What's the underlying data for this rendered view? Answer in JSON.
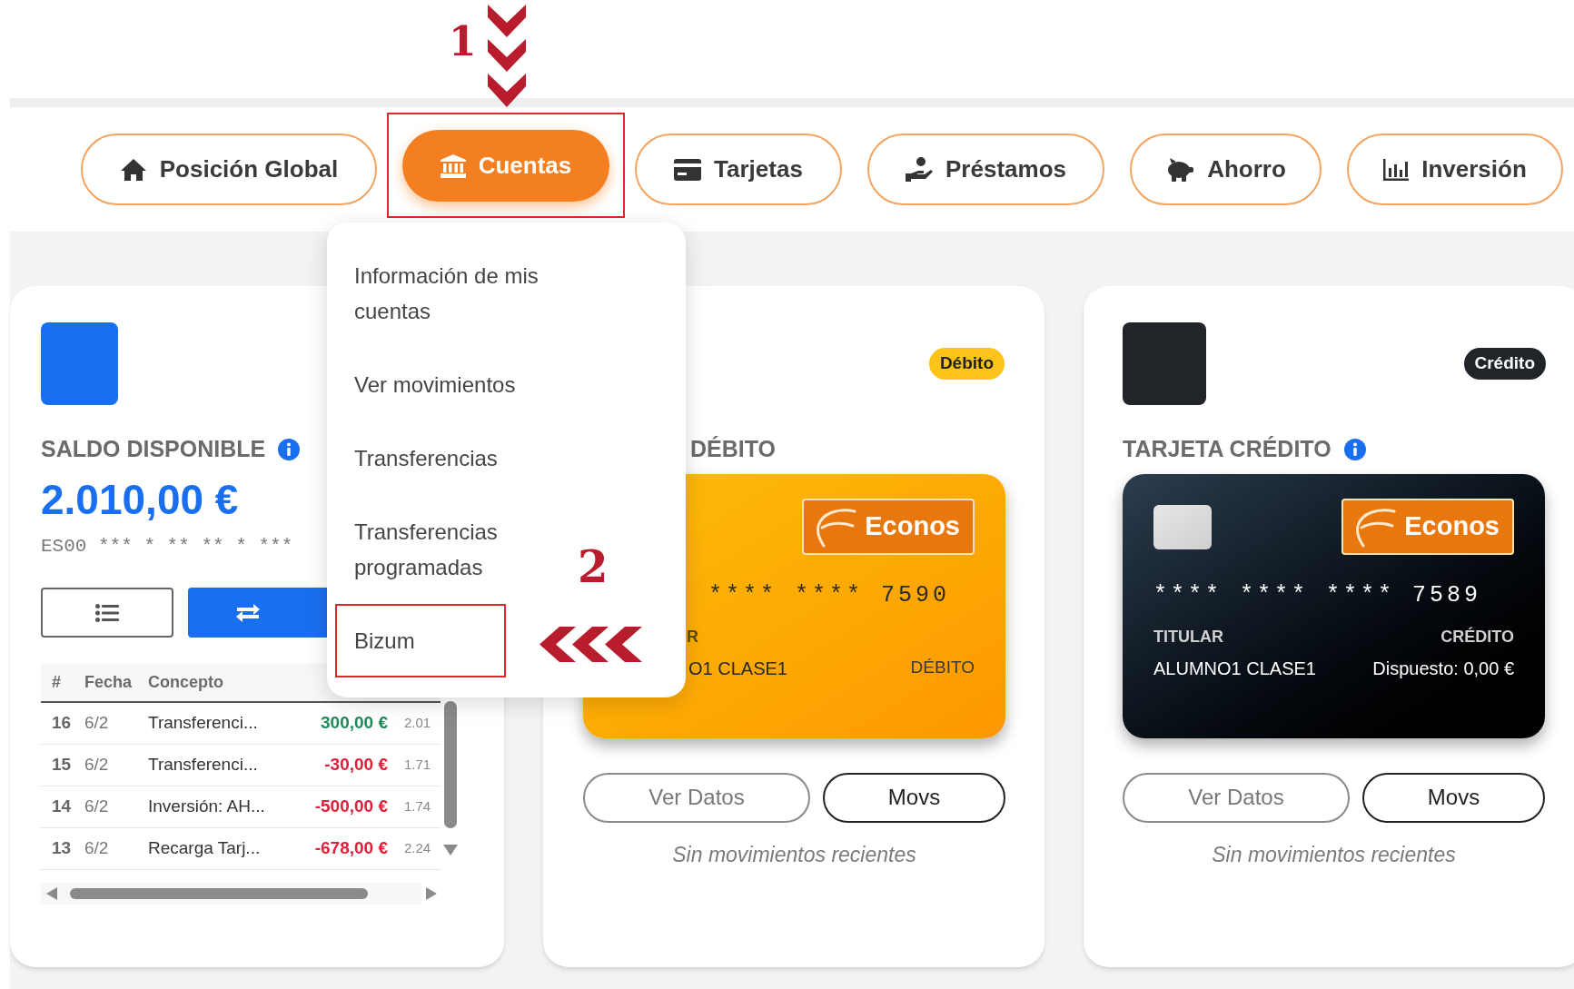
{
  "annotations": [
    {
      "label": "1"
    },
    {
      "label": "2"
    }
  ],
  "nav": [
    {
      "label": "Posición Global",
      "selected": false
    },
    {
      "label": "Cuentas",
      "selected": true
    },
    {
      "label": "Tarjetas",
      "selected": false
    },
    {
      "label": "Préstamos",
      "selected": false
    },
    {
      "label": "Ahorro",
      "selected": false
    },
    {
      "label": "Inversión",
      "selected": false
    }
  ],
  "dropdown": {
    "items": [
      {
        "label": "Información de mis cuentas",
        "highlighted": false
      },
      {
        "label": "Ver movimientos",
        "highlighted": false
      },
      {
        "label": "Transferencias",
        "highlighted": false
      },
      {
        "label": "Transferencias programadas",
        "highlighted": false
      },
      {
        "label": "Bizum",
        "highlighted": true
      }
    ]
  },
  "account": {
    "title": "SALDO DISPONIBLE",
    "balance": "2.010,00 €",
    "iban": "ES00 *** * ** ** * ***",
    "table": {
      "columns": [
        "#",
        "Fecha",
        "Concepto"
      ],
      "rows": [
        {
          "n": "16",
          "date": "6/2",
          "concept": "Transferenci...",
          "amount": "300,00 €",
          "balance": "2.01",
          "kind": "income"
        },
        {
          "n": "15",
          "date": "6/2",
          "concept": "Transferenci...",
          "amount": "-30,00 €",
          "balance": "1.71",
          "kind": "expense"
        },
        {
          "n": "14",
          "date": "6/2",
          "concept": "Inversión: AH...",
          "amount": "-500,00 €",
          "balance": "1.74",
          "kind": "expense"
        },
        {
          "n": "13",
          "date": "6/2",
          "concept": "Recarga Tarj...",
          "amount": "-678,00 €",
          "balance": "2.24",
          "kind": "expense"
        }
      ]
    }
  },
  "cards": [
    {
      "kind": "debit",
      "badge": "Débito",
      "title": "DÉBITO",
      "logo": "Econos",
      "number": "**** **** 7590",
      "holder_label": "R",
      "holder": "O1 CLASE1",
      "type_label": "DÉBITO",
      "buttons": [
        "Ver Datos",
        "Movs"
      ],
      "note": "Sin movimientos recientes"
    },
    {
      "kind": "credit",
      "badge": "Crédito",
      "title": "TARJETA CRÉDITO",
      "logo": "Econos",
      "number": "**** **** **** 7589",
      "holder_label": "TITULAR",
      "holder": "ALUMNO1 CLASE1",
      "type_label": "CRÉDITO",
      "spent": "Dispuesto: 0,00 €",
      "buttons": [
        "Ver Datos",
        "Movs"
      ],
      "note": "Sin movimientos recientes"
    }
  ]
}
